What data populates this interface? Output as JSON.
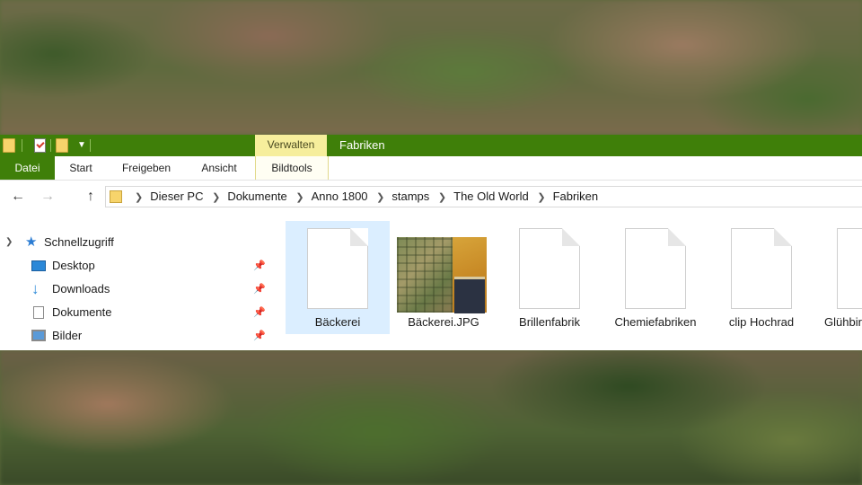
{
  "window": {
    "title": "Fabriken",
    "context_tab_group": "Verwalten"
  },
  "ribbon": {
    "tabs": [
      "Datei",
      "Start",
      "Freigeben",
      "Ansicht",
      "Bildtools"
    ]
  },
  "address": {
    "breadcrumb": [
      "Dieser PC",
      "Dokumente",
      "Anno 1800",
      "stamps",
      "The Old World",
      "Fabriken"
    ]
  },
  "nav_pane": {
    "quick_access": "Schnellzugriff",
    "items": [
      {
        "label": "Desktop",
        "icon": "desktop-icon",
        "pinned": true
      },
      {
        "label": "Downloads",
        "icon": "downloads-icon",
        "pinned": true
      },
      {
        "label": "Dokumente",
        "icon": "documents-icon",
        "pinned": true
      },
      {
        "label": "Bilder",
        "icon": "pictures-icon",
        "pinned": true
      }
    ]
  },
  "files": [
    {
      "name": "Bäckerei",
      "type": "file",
      "selected": true
    },
    {
      "name": "Bäckerei.JPG",
      "type": "image",
      "selected": false
    },
    {
      "name": "Brillenfabrik",
      "type": "file",
      "selected": false
    },
    {
      "name": "Chemiefabriken",
      "type": "file",
      "selected": false
    },
    {
      "name": "clip Hochrad",
      "type": "file",
      "selected": false
    },
    {
      "name": "Glühbir",
      "type": "file",
      "selected": false
    }
  ],
  "colors": {
    "titlebar": "#3f7f09",
    "context_tab": "#f6ee9c",
    "selection": "#cce8ff"
  }
}
